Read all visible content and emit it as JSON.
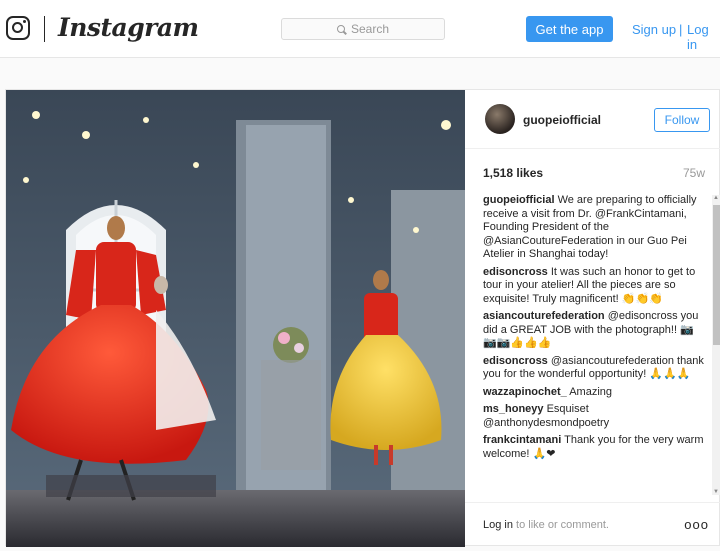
{
  "nav": {
    "wordmark": "Instagram",
    "search_placeholder": "Search",
    "get_app_label": "Get the app",
    "signup_label": "Sign up",
    "separator": "|",
    "login_label": "Log in"
  },
  "post": {
    "username": "guopeiofficial",
    "follow_label": "Follow",
    "likes": "1,518 likes",
    "age": "75w",
    "comments": [
      {
        "user": "guopeiofficial",
        "text": "We are preparing to officially receive a visit from Dr. @FrankCintamani, Founding President of the @AsianCoutureFederation in our Guo Pei Atelier in Shanghai today!"
      },
      {
        "user": "edisoncross",
        "text": "It was such an honor to get to tour in your atelier! All the pieces are so exquisite! Truly magnificent! 👏👏👏"
      },
      {
        "user": "asiancouturefederation",
        "text": "@edisoncross you did a GREAT JOB with the photograph!! 📷📷📷👍👍👍"
      },
      {
        "user": "edisoncross",
        "text": "@asiancouturefederation thank you for the wonderful opportunity! 🙏🙏🙏"
      },
      {
        "user": "wazzapinochet_",
        "text": "Amazing"
      },
      {
        "user": "ms_honeyy",
        "text": "Esquiset @anthonydesmondpoetry"
      },
      {
        "user": "frankcintamani",
        "text": "Thank you for the very warm welcome! 🙏❤"
      }
    ],
    "footer_login_link": "Log in",
    "footer_text": " to like or comment.",
    "more_icon": "ooo"
  },
  "colors": {
    "accent": "#3897f0",
    "text": "#262626",
    "muted": "#999999"
  }
}
